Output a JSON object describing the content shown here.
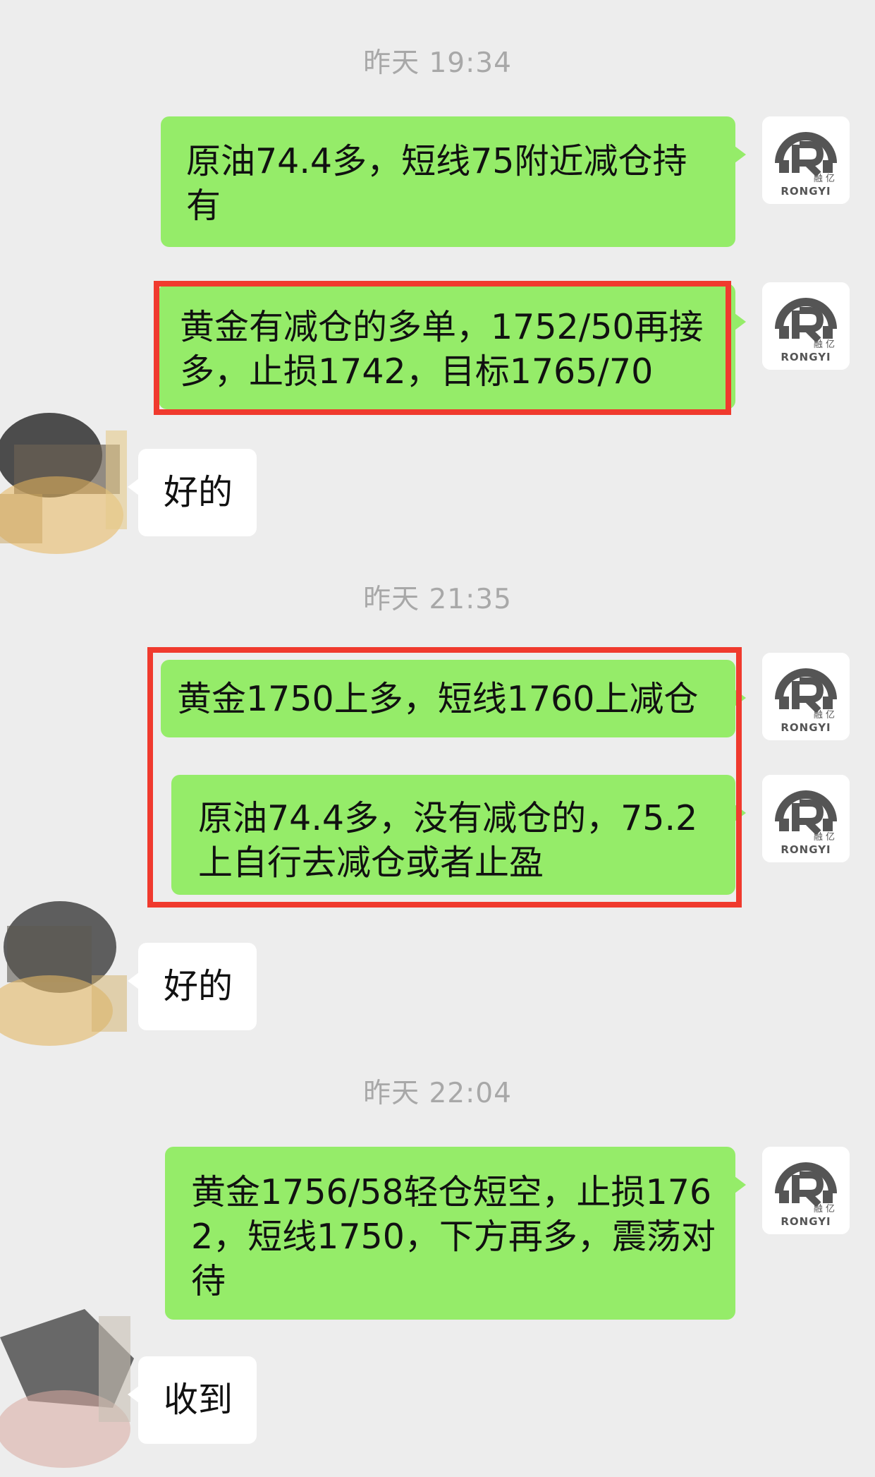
{
  "timestamps": [
    "昨天 19:34",
    "昨天 21:35",
    "昨天 22:04"
  ],
  "messages": [
    {
      "from": "me",
      "text": "原油74.4多，短线75附近减仓持有"
    },
    {
      "from": "me",
      "text": "黄金有减仓的多单，1752/50再接多，止损1742，目标1765/70",
      "highlighted": true
    },
    {
      "from": "other",
      "text": "好的"
    },
    {
      "from": "me",
      "text": "黄金1750上多，短线1760上减仓",
      "highlighted": true
    },
    {
      "from": "me",
      "text": "原油74.4多，没有减仓的，75.2上自行去减仓或者止盈",
      "highlighted": true
    },
    {
      "from": "other",
      "text": "好的"
    },
    {
      "from": "me",
      "text": "黄金1756/58轻仓短空，止损1762，短线1750，下方再多，震荡对待"
    },
    {
      "from": "other",
      "text": "收到"
    }
  ],
  "self_avatar": {
    "logo_text": "RONGYI",
    "logo_cn": "融 亿",
    "logo_letter": "R"
  },
  "colors": {
    "background": "#ededed",
    "outgoing_bubble": "#95ec69",
    "incoming_bubble": "#ffffff",
    "highlight_border": "#f03a2e",
    "timestamp": "#a8a8a8"
  }
}
